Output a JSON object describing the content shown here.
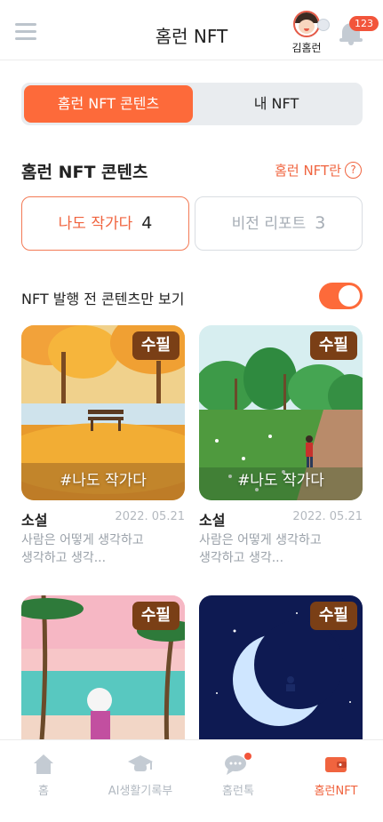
{
  "header": {
    "title": "홈런 NFT",
    "profile_name": "김홈런",
    "notification_count": "123"
  },
  "tabs": {
    "active": "홈런 NFT 콘텐츠",
    "inactive": "내 NFT"
  },
  "section": {
    "title": "홈런 NFT 콘텐츠",
    "link": "홈런 NFT란",
    "help": "?"
  },
  "categories": [
    {
      "label": "나도 작가다",
      "count": "4"
    },
    {
      "label": "비전 리포트",
      "count": "3"
    }
  ],
  "filter": {
    "label": "NFT 발행 전 콘텐츠만 보기",
    "enabled": true
  },
  "cards": [
    {
      "tag": "수필",
      "hashtag": "#나도 작가다",
      "category": "소설",
      "date": "2022. 05.21",
      "desc1": "사람은 어떻게 생각하고",
      "desc2": "생각하고 생각..."
    },
    {
      "tag": "수필",
      "hashtag": "#나도 작가다",
      "category": "소설",
      "date": "2022. 05.21",
      "desc1": "사람은 어떻게 생각하고",
      "desc2": "생각하고 생각..."
    },
    {
      "tag": "수필"
    },
    {
      "tag": "수필"
    }
  ],
  "bottom_nav": [
    {
      "label": "홈",
      "icon": "home-icon"
    },
    {
      "label": "AI생활기록부",
      "icon": "graduation-cap-icon"
    },
    {
      "label": "홈런톡",
      "icon": "chat-bubble-icon"
    },
    {
      "label": "홈런NFT",
      "icon": "wallet-icon"
    }
  ],
  "colors": {
    "accent": "#fd6a3a",
    "tag_bg": "#7a3f16",
    "muted": "#b2b9c1"
  }
}
